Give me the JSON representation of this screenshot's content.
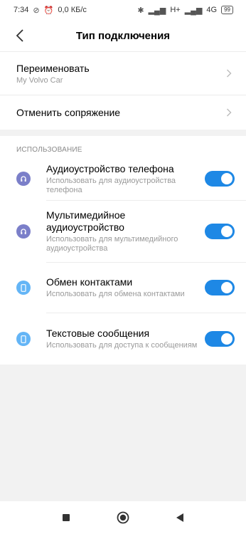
{
  "status_bar": {
    "time": "7:34",
    "speed": "0,0 КБ/с",
    "network_1": "H+",
    "network_2": "4G",
    "battery": "99"
  },
  "header": {
    "title": "Тип подключения"
  },
  "rename": {
    "title": "Переименовать",
    "subtitle": "My Volvo Car"
  },
  "unpair": {
    "title": "Отменить сопряжение"
  },
  "usage": {
    "section_label": "ИСПОЛЬЗОВАНИЕ",
    "items": [
      {
        "title": "Аудиоустройство телефона",
        "desc": "Использовать для аудиоустройства телефона",
        "icon": "headset-icon",
        "enabled": true
      },
      {
        "title": "Мультимедийное аудиоустройство",
        "desc": "Использовать для мультимедийного аудиоустройства",
        "icon": "headphones-icon",
        "enabled": true
      },
      {
        "title": "Обмен контактами",
        "desc": "Использовать для обмена контактами",
        "icon": "phone-icon",
        "enabled": true
      },
      {
        "title": "Текстовые сообщения",
        "desc": "Использовать для доступа к сообщениям",
        "icon": "phone-icon",
        "enabled": true
      }
    ]
  },
  "colors": {
    "toggle_on": "#1e88e5",
    "audio_icon_bg": "#7b7fc9",
    "phone_icon_bg": "#64b5f6"
  }
}
